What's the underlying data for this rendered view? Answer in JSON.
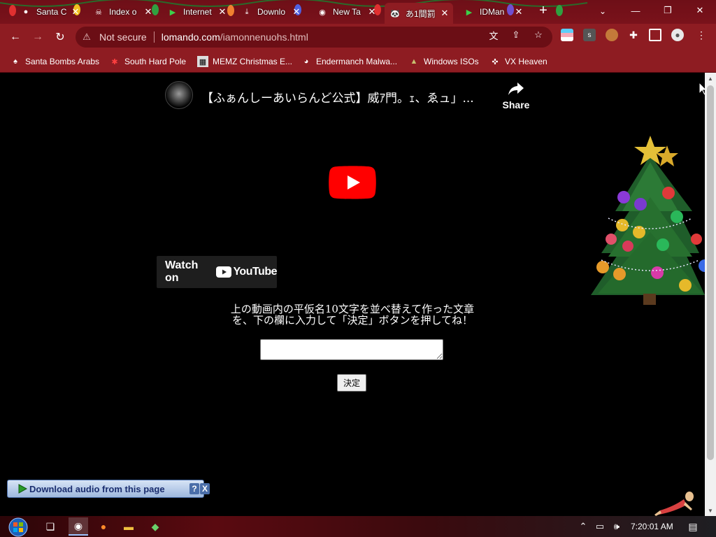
{
  "window": {
    "tabs": [
      {
        "label": "Santa C",
        "icon": "christmas-ornament-icon",
        "active": false
      },
      {
        "label": "Index o",
        "icon": "skull-icon",
        "active": false
      },
      {
        "label": "Internet",
        "icon": "green-flag-icon",
        "active": false
      },
      {
        "label": "Downlo",
        "icon": "download-icon",
        "active": false
      },
      {
        "label": "New Ta",
        "icon": "chrome-icon",
        "active": false
      },
      {
        "label": "あ1間罰",
        "icon": "panda-icon",
        "active": true
      },
      {
        "label": "IDMan",
        "icon": "green-flag-icon",
        "active": false
      }
    ],
    "close_glyph": "✕",
    "new_tab_glyph": "+",
    "controls": {
      "minimize": "—",
      "restore": "❐",
      "close": "✕"
    }
  },
  "toolbar": {
    "security_label": "Not secure",
    "url_host": "lomando.com",
    "url_path": "/iamonnenuohs.html"
  },
  "bookmarks": [
    {
      "label": "Santa Bombs Arabs",
      "icon": "santa-icon"
    },
    {
      "label": "South Hard Pole",
      "icon": "snowflake-icon"
    },
    {
      "label": "MEMZ Christmas E...",
      "icon": "memz-icon"
    },
    {
      "label": "Endermanch Malwa...",
      "icon": "panda-icon"
    },
    {
      "label": "Windows ISOs",
      "icon": "tree-icon"
    },
    {
      "label": "VX Heaven",
      "icon": "vx-icon"
    }
  ],
  "video": {
    "title": "【ふぁんしーあいらんど公式】威ｱ門。ｪ、ゑュ」...",
    "share_label": "Share",
    "watch_label": "Watch on",
    "youtube_logo": "YouTube"
  },
  "form": {
    "instruction_line1": "上の動画内の平仮名10文字を並べ替えて作った文章",
    "instruction_line2": "を、下の欄に入力して「決定」ボタンを押してね！",
    "answer_value": "",
    "submit_label": "決定"
  },
  "download_bar": {
    "label": "Download audio from this page",
    "help": "?",
    "close": "X"
  },
  "taskbar": {
    "clock": "7:20:01 AM"
  },
  "colors": {
    "chrome_bg": "#8e1c22",
    "tabstrip_bg": "#7a121b",
    "youtube_red": "#ff0000",
    "page_bg": "#000000"
  }
}
